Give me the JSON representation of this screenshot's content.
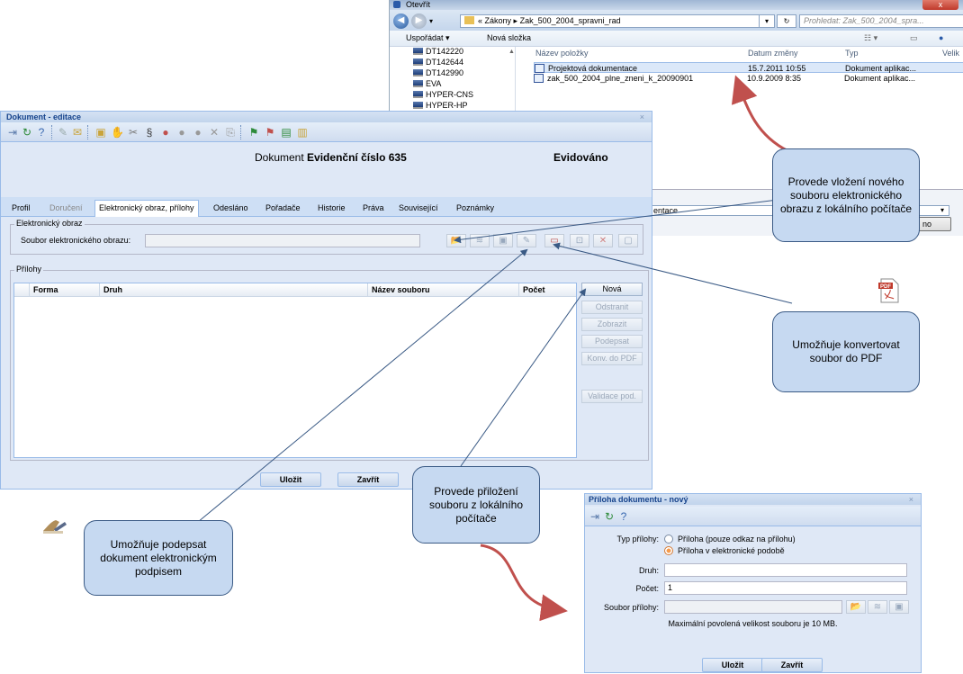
{
  "open_dialog": {
    "title": "Otevřít",
    "close": "x",
    "breadcrumb": [
      "«",
      "Zákony",
      "Zak_500_2004_spravni_rad"
    ],
    "search_placeholder": "Prohledat: Zak_500_2004_spra...",
    "toolbar": {
      "organize": "Uspořádat ▾",
      "new_folder": "Nová složka"
    },
    "tree": [
      "DT142220",
      "DT142644",
      "DT142990",
      "EVA",
      "HYPER-CNS",
      "HYPER-HP"
    ],
    "columns": [
      "Název položky",
      "Datum změny",
      "Typ",
      "Velik"
    ],
    "files": [
      {
        "name": "Projektová dokumentace",
        "date": "15.7.2011 10:55",
        "type": "Dokument aplikac..."
      },
      {
        "name": "zak_500_2004_plne_zneni_k_20090901",
        "date": "10.9.2009 8:35",
        "type": "Dokument aplikac..."
      }
    ],
    "filename_value": "entace",
    "open_button": "no"
  },
  "editor": {
    "title": "Dokument - editace",
    "close": "×",
    "doc_prefix": "Dokument",
    "doc_number": "Evidenční číslo 635",
    "status": "Evidováno",
    "tabs": [
      "Profil",
      "Doručení",
      "Elektronický obraz, přílohy",
      "Odesláno",
      "Pořadače",
      "Historie",
      "Práva",
      "Související",
      "Poznámky"
    ],
    "eobraz_legend": "Elektronický obraz",
    "eobraz_label": "Soubor elektronického obrazu:",
    "prilohy_legend": "Přílohy",
    "grid_columns": [
      "Forma",
      "Druh",
      "Název souboru",
      "Počet"
    ],
    "side_buttons": [
      "Nová",
      "Odstranit",
      "Zobrazit",
      "Podepsat",
      "Konv. do PDF",
      "Validace pod."
    ],
    "save": "Uložit",
    "close_btn": "Zavřít"
  },
  "callouts": {
    "insert_new": "Provede vložení nového souboru elektronického obrazu z lokálního počítače",
    "convert_pdf": "Umožňuje konvertovat soubor do PDF",
    "attach": "Provede přiložení souboru z lokálního počítače",
    "sign": "Umožňuje podepsat dokument elektronickým podpisem"
  },
  "attach_dialog": {
    "title": "Příloha dokumentu - nový",
    "close": "×",
    "type_label": "Typ přílohy:",
    "option_link": "Příloha (pouze odkaz na přílohu)",
    "option_electronic": "Příloha v elektronické podobě",
    "druh_label": "Druh:",
    "druh_value": "",
    "pocet_label": "Počet:",
    "pocet_value": "1",
    "soubor_label": "Soubor přílohy:",
    "max_note": "Maximální povolená velikost souboru je 10 MB.",
    "save": "Uložit",
    "close_btn": "Zavřít"
  },
  "colors": {
    "accent": "#99bbe8",
    "callout_fill": "#c6d9f1",
    "arrow_red": "#c0504d"
  }
}
